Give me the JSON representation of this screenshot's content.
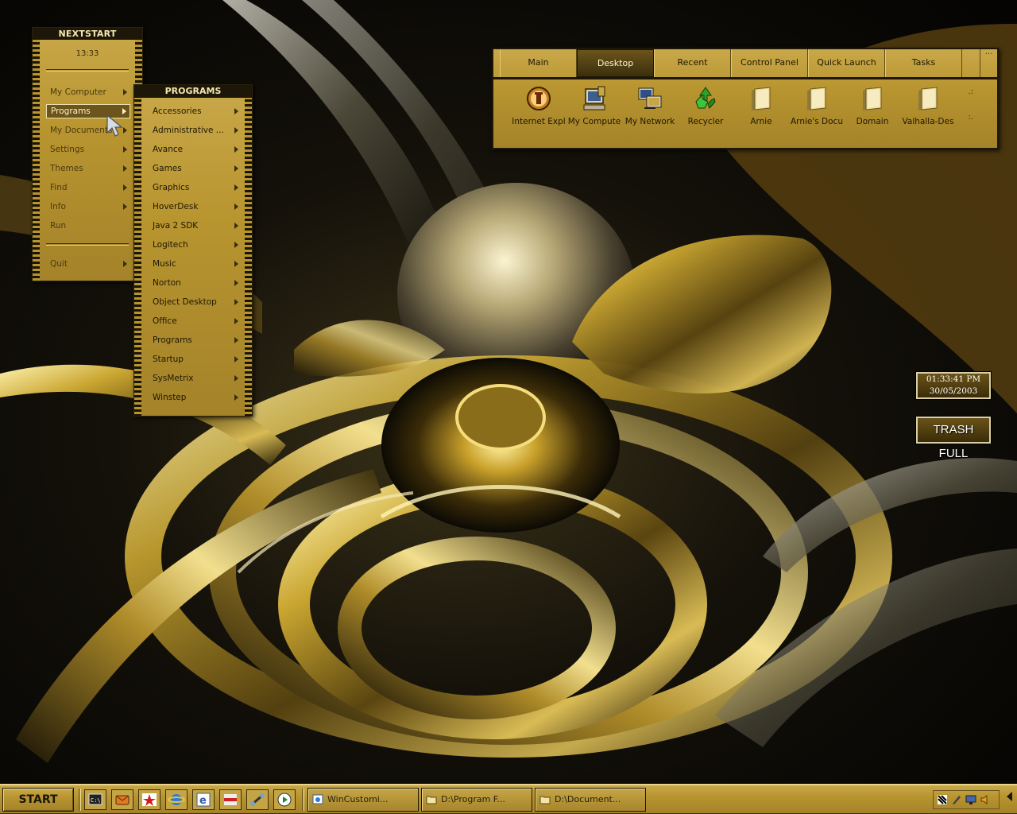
{
  "nextstart": {
    "title": "NEXTSTART",
    "time": "13:33",
    "items": [
      {
        "label": "My Computer",
        "submenu": true
      },
      {
        "label": "Programs",
        "submenu": true,
        "selected": true
      },
      {
        "label": "My Documents",
        "submenu": true
      },
      {
        "label": "Settings",
        "submenu": true
      },
      {
        "label": "Themes",
        "submenu": true
      },
      {
        "label": "Find",
        "submenu": true
      },
      {
        "label": "Info",
        "submenu": true
      },
      {
        "label": "Run",
        "submenu": false
      }
    ],
    "quit": "Quit"
  },
  "programs": {
    "title": "PROGRAMS",
    "items": [
      "Accessories",
      "Administrative ...",
      "Avance",
      "Games",
      "Graphics",
      "HoverDesk",
      "Java 2 SDK",
      "Logitech",
      "Music",
      "Norton",
      "Object Desktop",
      "Office",
      "Programs",
      "Startup",
      "SysMetrix",
      "Winstep"
    ]
  },
  "deskbar": {
    "tabs": [
      "Main",
      "Desktop",
      "Recent",
      "Control Panel",
      "Quick Launch",
      "Tasks"
    ],
    "active_tab": "Desktop",
    "icons": [
      {
        "label": "Internet Expl",
        "icon": "internet-explorer-icon"
      },
      {
        "label": "My Compute",
        "icon": "my-computer-icon"
      },
      {
        "label": "My Network",
        "icon": "my-network-icon"
      },
      {
        "label": "Recycler",
        "icon": "recycle-bin-icon"
      },
      {
        "label": "Arnie",
        "icon": "folder-icon"
      },
      {
        "label": "Arnie's Docu",
        "icon": "folder-icon"
      },
      {
        "label": "Domain",
        "icon": "folder-icon"
      },
      {
        "label": "Valhalla-Des",
        "icon": "folder-icon"
      }
    ]
  },
  "clock": {
    "time": "01:33:41 PM",
    "date": "30/05/2003"
  },
  "trash": {
    "label": "TRASH FULL"
  },
  "taskbar": {
    "start": "START",
    "quick_launch": [
      "command-prompt-icon",
      "mail-icon",
      "star-app-icon",
      "internet-explorer-icon",
      "ie-alt-icon",
      "flag-app-icon",
      "network-tool-icon",
      "media-player-icon"
    ],
    "tasks": [
      {
        "label": "WinCustomi...",
        "icon": "ie-page-icon"
      },
      {
        "label": "D:\\Program F...",
        "icon": "folder-icon"
      },
      {
        "label": "D:\\Document...",
        "icon": "folder-icon"
      }
    ]
  },
  "colors": {
    "gold": "#b8952f",
    "dark": "#1c1708",
    "highlight": "#6b551c"
  }
}
